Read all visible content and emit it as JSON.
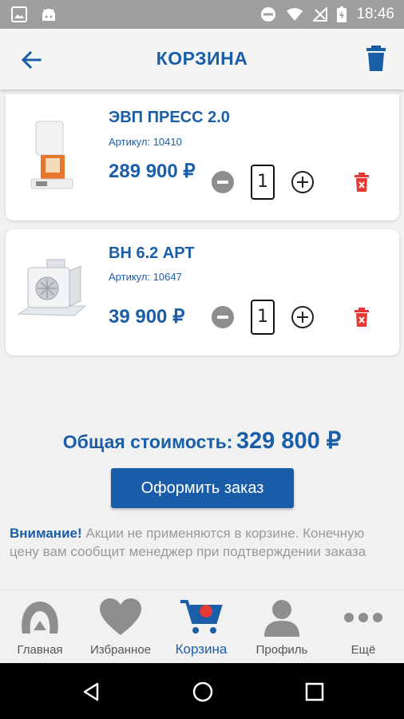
{
  "status_bar": {
    "time": "18:46",
    "icons": [
      "gallery-icon",
      "android-icon",
      "dnd-icon",
      "wifi-icon",
      "no-signal-icon",
      "battery-charging-icon"
    ]
  },
  "header": {
    "title": "КОРЗИНА",
    "back_icon": "arrow-left-icon",
    "clear_icon": "trash-icon"
  },
  "cart": {
    "items": [
      {
        "name": "ЭВП ПРЕСС 2.0",
        "sku": "Артикул: 10410",
        "price": "289 900 ₽",
        "qty": "1"
      },
      {
        "name": "ВН 6.2 АРТ",
        "sku": "Артикул: 10647",
        "price": "39 900 ₽",
        "qty": "1"
      }
    ]
  },
  "total": {
    "label": "Общая стоимость:",
    "value": "329 800 ₽"
  },
  "order_button": "Оформить заказ",
  "notice": {
    "bold": "Внимание!",
    "text": " Акции не применяются в корзине. Конечную цену вам сообщит менеджер при подтверждении заказа"
  },
  "bottom_nav": [
    {
      "label": "Главная",
      "icon": "home-logo-icon"
    },
    {
      "label": "Избранное",
      "icon": "heart-icon"
    },
    {
      "label": "Корзина",
      "icon": "cart-icon",
      "active": true
    },
    {
      "label": "Профиль",
      "icon": "person-icon"
    },
    {
      "label": "Ещё",
      "icon": "more-dots-icon"
    }
  ],
  "colors": {
    "primary": "#1b5ea8",
    "delete": "#e53935",
    "inactive": "#8e8e8e"
  }
}
